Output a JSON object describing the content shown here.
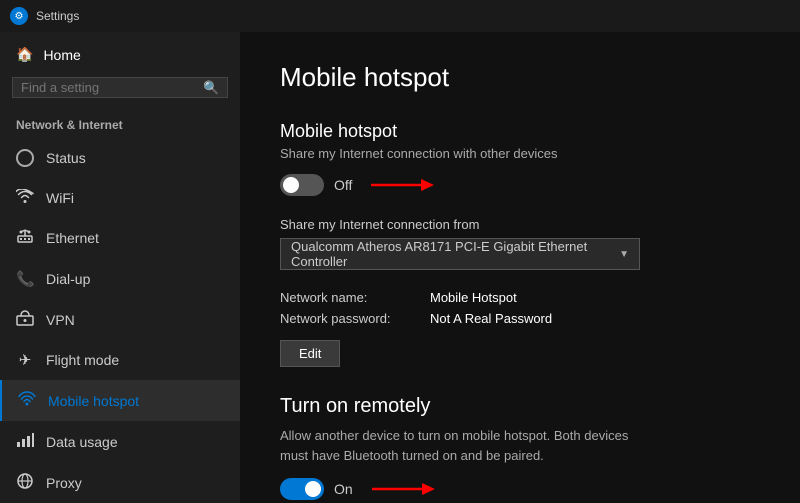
{
  "titleBar": {
    "icon": "⚙",
    "text": "Settings"
  },
  "sidebar": {
    "homeLabel": "Home",
    "searchPlaceholder": "Find a setting",
    "sectionLabel": "Network & Internet",
    "items": [
      {
        "id": "status",
        "label": "Status",
        "icon": "○",
        "active": false
      },
      {
        "id": "wifi",
        "label": "WiFi",
        "icon": "📶",
        "active": false
      },
      {
        "id": "ethernet",
        "label": "Ethernet",
        "icon": "🔌",
        "active": false
      },
      {
        "id": "dialup",
        "label": "Dial-up",
        "icon": "📞",
        "active": false
      },
      {
        "id": "vpn",
        "label": "VPN",
        "icon": "🔒",
        "active": false
      },
      {
        "id": "flightmode",
        "label": "Flight mode",
        "icon": "✈",
        "active": false
      },
      {
        "id": "mobilehotspot",
        "label": "Mobile hotspot",
        "icon": "📡",
        "active": true
      },
      {
        "id": "datausage",
        "label": "Data usage",
        "icon": "📊",
        "active": false
      },
      {
        "id": "proxy",
        "label": "Proxy",
        "icon": "🌐",
        "active": false
      }
    ]
  },
  "content": {
    "pageTitle": "Mobile hotspot",
    "hotspot": {
      "sectionTitle": "Mobile hotspot",
      "description": "Share my Internet connection with other devices",
      "toggleState": "off",
      "toggleLabel": "Off"
    },
    "shareFrom": {
      "label": "Share my Internet connection from",
      "dropdownValue": "Qualcomm Atheros AR8171 PCI-E Gigabit Ethernet Controller"
    },
    "networkInfo": {
      "nameLabelText": "Network name:",
      "nameValue": "Mobile Hotspot",
      "passwordLabelText": "Network password:",
      "passwordValue": "Not A Real Password",
      "editLabel": "Edit"
    },
    "remote": {
      "title": "Turn on remotely",
      "description": "Allow another device to turn on mobile hotspot. Both devices must have Bluetooth turned on and be paired.",
      "toggleState": "on",
      "toggleLabel": "On"
    }
  }
}
